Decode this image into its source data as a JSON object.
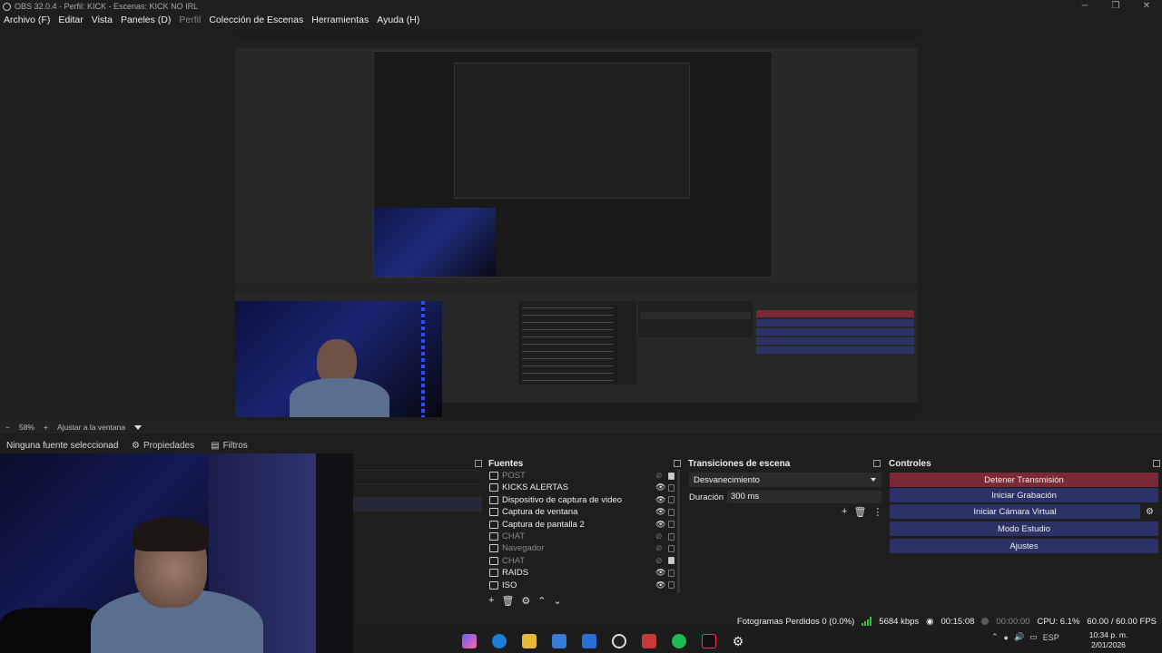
{
  "window": {
    "title": "OBS 32.0.4 - Perfil: KICK - Escenas: KICK NO IRL",
    "controls": [
      "─",
      "❐",
      "✕"
    ]
  },
  "menu": [
    {
      "label": "Archivo (F)",
      "enabled": true
    },
    {
      "label": "Editar",
      "enabled": true
    },
    {
      "label": "Vista",
      "enabled": true
    },
    {
      "label": "Paneles (D)",
      "enabled": true
    },
    {
      "label": "Perfil",
      "enabled": false
    },
    {
      "label": "Colección de Escenas",
      "enabled": true
    },
    {
      "label": "Herramientas",
      "enabled": true
    },
    {
      "label": "Ayuda (H)",
      "enabled": true
    }
  ],
  "zoombar": {
    "minus": "−",
    "zoom": "58%",
    "plus": "+",
    "fit_label": "Ajustar a la ventana"
  },
  "source_bar": {
    "no_source": "Ninguna fuente seleccionad",
    "properties": "Propiedades",
    "filters": "Filtros"
  },
  "fuentes": {
    "title": "Fuentes",
    "items": [
      {
        "label": "POST",
        "visible": false,
        "locked": true,
        "icon": "image-icon"
      },
      {
        "label": "KICKS ALERTAS",
        "visible": true,
        "locked": false,
        "icon": "globe-icon"
      },
      {
        "label": "Dispositivo de captura de video",
        "visible": true,
        "locked": false,
        "icon": "camera-icon"
      },
      {
        "label": "Captura de ventana",
        "visible": true,
        "locked": false,
        "icon": "window-icon"
      },
      {
        "label": "Captura de pantalla 2",
        "visible": true,
        "locked": false,
        "icon": "monitor-icon"
      },
      {
        "label": "CHAT",
        "visible": false,
        "locked": false,
        "icon": "globe-icon"
      },
      {
        "label": "Navegador",
        "visible": false,
        "locked": false,
        "icon": "globe-icon"
      },
      {
        "label": "CHAT",
        "visible": false,
        "locked": true,
        "icon": "globe-icon"
      },
      {
        "label": "RAIDS",
        "visible": true,
        "locked": false,
        "icon": "globe-icon"
      },
      {
        "label": "ISO",
        "visible": true,
        "locked": false,
        "icon": "camera-icon"
      }
    ],
    "tools": [
      "+",
      "🗑",
      "⚙",
      "⌃",
      "⌄"
    ]
  },
  "transiciones": {
    "title": "Transiciones de escena",
    "selected": "Desvanecimiento",
    "duration_label": "Duración",
    "duration_value": "300 ms",
    "tools": [
      "+",
      "🗑",
      "⋮"
    ]
  },
  "controles": {
    "title": "Controles",
    "buttons": [
      {
        "label": "Detener Transmisión",
        "style": "danger"
      },
      {
        "label": "Iniciar Grabación",
        "style": "normal"
      },
      {
        "label": "Iniciar Cámara Virtual",
        "style": "normal"
      },
      {
        "label": "Modo Estudio",
        "style": "normal"
      },
      {
        "label": "Ajustes",
        "style": "normal"
      }
    ]
  },
  "status": {
    "dropped_frames": "Fotogramas Perdidos 0 (0.0%)",
    "bitrate": "5684 kbps",
    "stream_time": "00:15:08",
    "rec_time": "00:00:00",
    "cpu": "CPU: 6.1%",
    "fps": "60.00 / 60.00 FPS"
  },
  "tray": {
    "language": "ESP",
    "time": "10:34 p. m.",
    "date": "2/01/2026"
  },
  "colors": {
    "danger": "#7c2936",
    "button": "#2a3268",
    "bitrate_green": "#3fbf3f"
  }
}
